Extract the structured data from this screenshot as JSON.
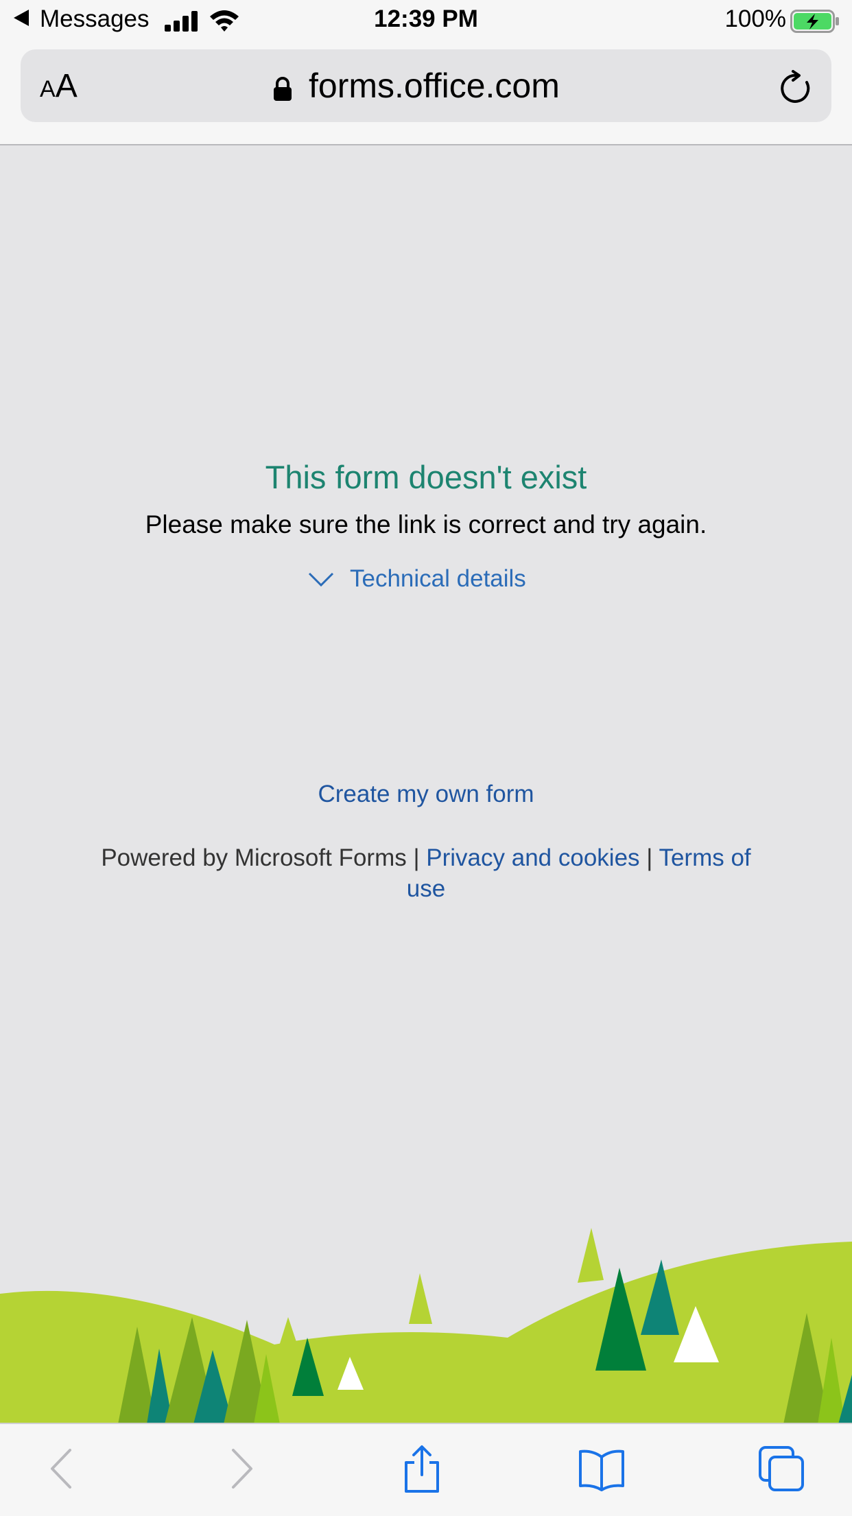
{
  "status_bar": {
    "back_app": "Messages",
    "time": "12:39 PM",
    "battery_percent": "100%"
  },
  "address_bar": {
    "text_size_small": "A",
    "text_size_large": "A",
    "url": "forms.office.com"
  },
  "page": {
    "error_title": "This form doesn't exist",
    "error_message": "Please make sure the link is correct and try again.",
    "technical_details": "Technical details",
    "create_form": "Create my own form",
    "powered_by": "Powered by Microsoft Forms",
    "separator": " | ",
    "privacy_link": "Privacy and cookies",
    "terms_link": "Terms of use"
  },
  "colors": {
    "title_green": "#1d8470",
    "link_blue": "#1f55a0",
    "toolbar_icon_blue": "#1a73e8",
    "toolbar_icon_disabled": "#b9b9bd"
  },
  "toolbar": {
    "items": [
      {
        "icon": "back-chevron-icon",
        "enabled": false
      },
      {
        "icon": "forward-chevron-icon",
        "enabled": false
      },
      {
        "icon": "share-icon",
        "enabled": true
      },
      {
        "icon": "bookmarks-book-icon",
        "enabled": true
      },
      {
        "icon": "tabs-icon",
        "enabled": true
      }
    ]
  }
}
